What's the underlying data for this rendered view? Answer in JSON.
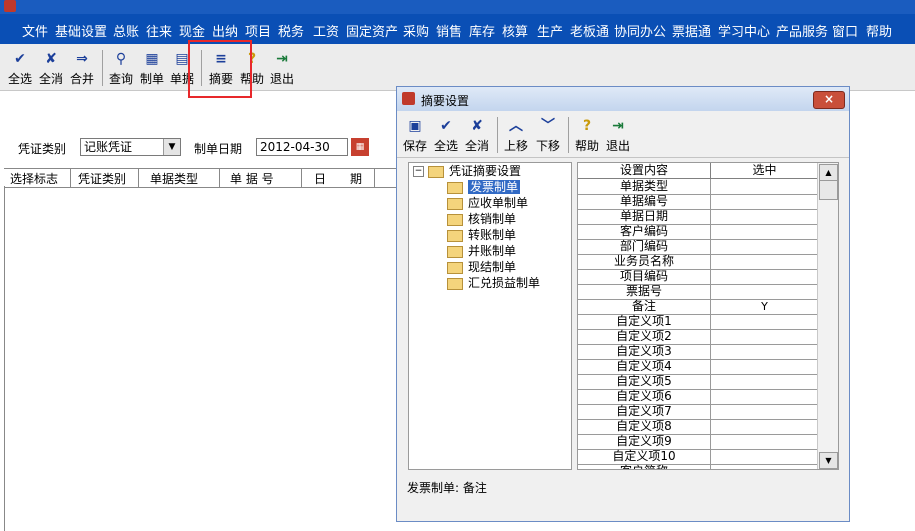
{
  "menu": [
    "文件",
    "基础设置",
    "总账",
    "往来",
    "现金",
    "出纳",
    "项目",
    "税务",
    "工资",
    "固定资产",
    "采购",
    "销售",
    "库存",
    "核算",
    "生产",
    "老板通",
    "协同办公",
    "票据通",
    "学习中心",
    "产品服务",
    "窗口",
    "帮助"
  ],
  "toolbar": {
    "select_all": "全选",
    "deselect_all": "全消",
    "merge": "合并",
    "query": "查询",
    "make_voucher": "制单",
    "document": "单据",
    "summary": "摘要",
    "help": "帮助",
    "exit": "退出"
  },
  "form": {
    "voucher_type_label": "凭证类别",
    "voucher_type_value": "记账凭证",
    "date_label": "制单日期",
    "date_value": "2012-04-30"
  },
  "grid_headers": [
    "选择标志",
    "凭证类别",
    "单据类型",
    "单 据 号",
    "日　　期"
  ],
  "dialog": {
    "title": "摘要设置",
    "close": "×",
    "toolbar": {
      "save": "保存",
      "select_all": "全选",
      "deselect_all": "全消",
      "move_up": "上移",
      "move_down": "下移",
      "help": "帮助",
      "exit": "退出"
    },
    "tree_root": "凭证摘要设置",
    "tree_items": [
      "发票制单",
      "应收单制单",
      "核销制单",
      "转账制单",
      "并账制单",
      "现结制单",
      "汇兑损益制单"
    ],
    "table_headers": [
      "设置内容",
      "选中"
    ],
    "rows": [
      {
        "name": "单据类型",
        "checked": ""
      },
      {
        "name": "单据编号",
        "checked": ""
      },
      {
        "name": "单据日期",
        "checked": ""
      },
      {
        "name": "客户编码",
        "checked": ""
      },
      {
        "name": "部门编码",
        "checked": ""
      },
      {
        "name": "业务员名称",
        "checked": ""
      },
      {
        "name": "项目编码",
        "checked": ""
      },
      {
        "name": "票据号",
        "checked": ""
      },
      {
        "name": "备注",
        "checked": "Y"
      },
      {
        "name": "自定义项1",
        "checked": ""
      },
      {
        "name": "自定义项2",
        "checked": ""
      },
      {
        "name": "自定义项3",
        "checked": ""
      },
      {
        "name": "自定义项4",
        "checked": ""
      },
      {
        "name": "自定义项5",
        "checked": ""
      },
      {
        "name": "自定义项6",
        "checked": ""
      },
      {
        "name": "自定义项7",
        "checked": ""
      },
      {
        "name": "自定义项8",
        "checked": ""
      },
      {
        "name": "自定义项9",
        "checked": ""
      },
      {
        "name": "自定义项10",
        "checked": ""
      },
      {
        "name": "客户简称",
        "checked": ""
      }
    ],
    "status": "发票制单: 备注"
  }
}
